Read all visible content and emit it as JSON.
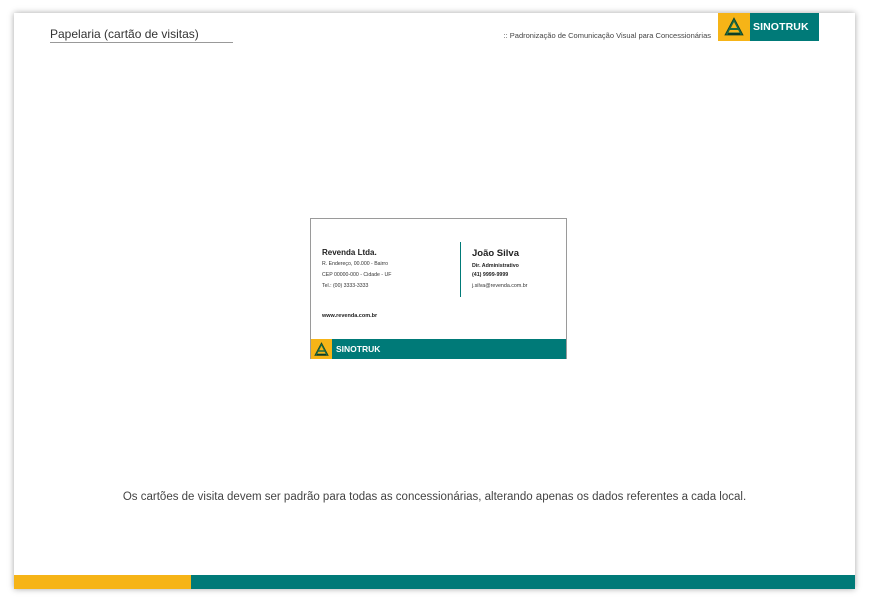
{
  "header": {
    "title": "Papelaria (cartão de visitas)",
    "subtitle": ":: Padronização de Comunicação Visual para Concessionárias"
  },
  "brand": {
    "name": "SINOTRUK",
    "logo_icon": "sinotruk-emblem-icon"
  },
  "card": {
    "company": "Revenda Ltda.",
    "address_lines": [
      "R. Endereço, 00.000 - Bairro",
      "CEP 00000-000 - Cidade - UF",
      "Tel.: (00) 3333-3333"
    ],
    "website": "www.revenda.com.br",
    "person_name": "João Silva",
    "person_role": "Dir. Administrativo",
    "person_phone": "(41) 9999-9999",
    "person_email": "j.silva@revenda.com.br",
    "footer_brand": "SINOTRUK"
  },
  "caption": "Os cartões de visita devem ser padrão para todas as concessionárias, alterando apenas os dados referentes a cada local.",
  "colors": {
    "accent_yellow": "#f6b417",
    "accent_teal": "#007a78"
  }
}
